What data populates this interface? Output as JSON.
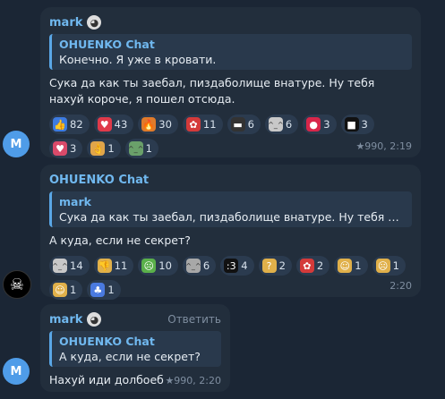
{
  "msg1": {
    "sender": "mark",
    "quote_name": "OHUENKO Chat",
    "quote_text": "Конечно. Я уже в кровати.",
    "text": "Сука да как ты заебал, пиздаболище внатуре. Ну тебя нахуй короче, я пошел отсюда.",
    "reactions": [
      {
        "icon": "thumbs-up-icon",
        "glyph": "👍",
        "bg": "#3d7be0",
        "count": "82"
      },
      {
        "icon": "heart-icon",
        "glyph": "♥",
        "bg": "#e03a4a",
        "count": "43"
      },
      {
        "icon": "fire-icon",
        "glyph": "🔥",
        "bg": "#e07b2a",
        "count": "30"
      },
      {
        "icon": "broken-heart-icon",
        "glyph": "✿",
        "bg": "#d43a3a",
        "count": "11"
      },
      {
        "icon": "sticker-icon",
        "glyph": "▬",
        "bg": "#333",
        "count": "6"
      },
      {
        "icon": "cat-sticker-icon",
        "glyph": "",
        "bg": "#c8c8c8",
        "count": "6"
      },
      {
        "icon": "strawberry-icon",
        "glyph": "●",
        "bg": "#d8264a",
        "count": "3"
      },
      {
        "icon": "dark-sticker-icon",
        "glyph": "■",
        "bg": "#111",
        "count": "3"
      },
      {
        "icon": "heart-outline-icon",
        "glyph": "♥",
        "bg": "#d94a6a",
        "count": "3"
      },
      {
        "icon": "ok-hand-icon",
        "glyph": "👌",
        "bg": "#e0a54a",
        "count": "1"
      },
      {
        "icon": "cat-face-icon",
        "glyph": "☺",
        "bg": "#6aa06a",
        "count": "1"
      }
    ],
    "meta": "★990, 2:19",
    "avatar_letter": "M",
    "avatar_color": "#4f9ce8"
  },
  "msg2": {
    "sender": "OHUENKO Chat",
    "quote_name": "mark",
    "quote_text": "Сука да как ты заебал, пиздаболище внатуре. Ну тебя нахуй ...",
    "text": "А куда, если не секрет?",
    "reactions": [
      {
        "icon": "cat-sticker-icon",
        "glyph": "",
        "bg": "#c8c8c8",
        "count": "14"
      },
      {
        "icon": "thumbs-down-icon",
        "glyph": "👎",
        "bg": "#e0b04a",
        "count": "11"
      },
      {
        "icon": "nauseated-icon",
        "glyph": "☹",
        "bg": "#5ab04a",
        "count": "10"
      },
      {
        "icon": "cat-photo-icon",
        "glyph": "",
        "bg": "#a8a8a8",
        "count": "6"
      },
      {
        "icon": "colon-three-icon",
        "glyph": ":3",
        "bg": "#111",
        "count": "4"
      },
      {
        "icon": "thinking-icon",
        "glyph": "?",
        "bg": "#e0b04a",
        "count": "2"
      },
      {
        "icon": "broken-heart-icon",
        "glyph": "✿",
        "bg": "#d43a3a",
        "count": "2"
      },
      {
        "icon": "grimace-icon",
        "glyph": "☺",
        "bg": "#e0b04a",
        "count": "1"
      },
      {
        "icon": "crying-icon",
        "glyph": "☹",
        "bg": "#e0b04a",
        "count": "1"
      },
      {
        "icon": "hug-icon",
        "glyph": "☺",
        "bg": "#e0b04a",
        "count": "1"
      },
      {
        "icon": "person-icon",
        "glyph": "♣",
        "bg": "#4a7ae0",
        "count": "1"
      }
    ],
    "meta": "2:20",
    "avatar_glyph": "☠"
  },
  "msg3": {
    "sender": "mark",
    "reply_label": "Ответить",
    "quote_name": "OHUENKO Chat",
    "quote_text": "А куда, если не секрет?",
    "text": "Нахуй иди долбоеб",
    "meta": "★990, 2:20",
    "avatar_letter": "M",
    "avatar_color": "#4f9ce8"
  }
}
